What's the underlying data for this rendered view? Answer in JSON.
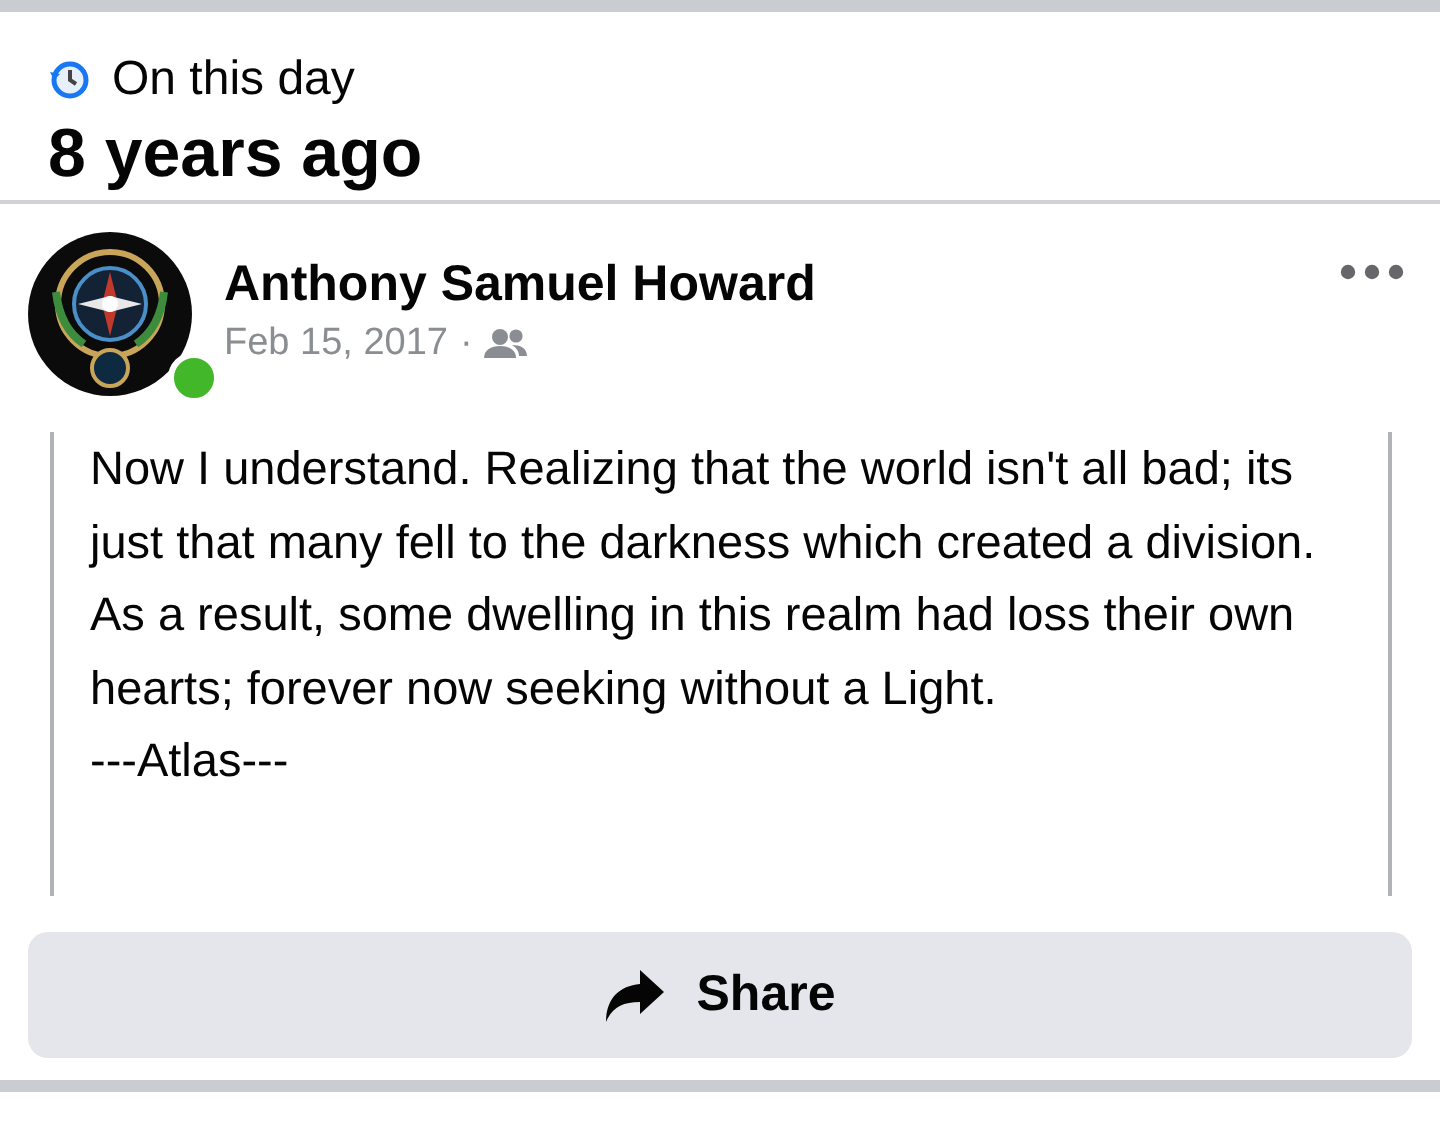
{
  "memory_header": {
    "label": "On this day",
    "title": "8 years ago"
  },
  "post": {
    "author": "Anthony Samuel Howard",
    "online": true,
    "date": "Feb 15, 2017",
    "separator": "·",
    "body_lines": [
      "Now I understand. Realizing that the world isn't all bad; its just that many fell to the darkness which created a division. As a result, some dwelling in this realm had loss their own hearts; forever now seeking without a Light.",
      "---Atlas---"
    ]
  },
  "share_button": {
    "label": "Share"
  }
}
